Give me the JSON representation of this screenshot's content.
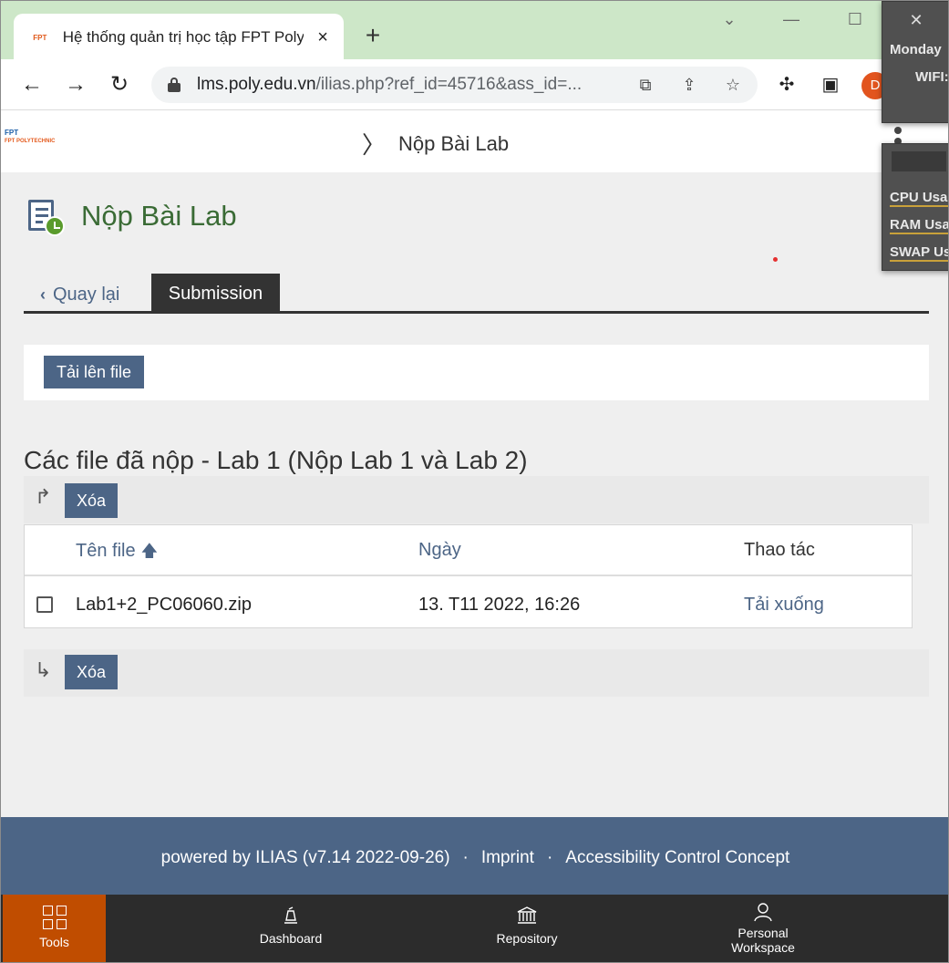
{
  "browser": {
    "tab_title": "Hệ thống quản trị học tập FPT Polytechnic",
    "tab_close": "×",
    "new_tab": "+",
    "url_host": "lms.poly.edu.vn",
    "url_rest": "/ilias.php?ref_id=45716&ass_id=...",
    "profile_initial": "D"
  },
  "overlay": {
    "day": "Monday",
    "wifi": "WIFI:",
    "cpu": "CPU Usag",
    "ram": "RAM Usag",
    "swap": "SWAP Us"
  },
  "header": {
    "logo_top": "FPT",
    "logo_bottom": "FPT POLYTECHNIC",
    "breadcrumb": "Nộp Bài Lab"
  },
  "page": {
    "title": "Nộp Bài Lab",
    "tabs": {
      "back": "Quay lại",
      "active": "Submission"
    },
    "upload_button": "Tải lên file",
    "section_title": "Các file đã nộp - Lab 1 (Nộp Lab 1 và Lab 2)",
    "delete_button": "Xóa",
    "table": {
      "columns": [
        "Tên file",
        "Ngày",
        "Thao tác"
      ],
      "rows": [
        {
          "file": "Lab1+2_PC06060.zip",
          "date": "13. T11 2022, 16:26",
          "action": "Tải xuống"
        }
      ]
    }
  },
  "footer": {
    "powered": "powered by ILIAS (v7.14 2022-09-26)",
    "imprint": "Imprint",
    "accessibility": "Accessibility Control Concept",
    "separator": "·"
  },
  "bottom_nav": {
    "tools": "Tools",
    "dashboard": "Dashboard",
    "repository": "Repository",
    "personal_line1": "Personal",
    "personal_line2": "Workspace"
  },
  "colors": {
    "accent": "#4c6586",
    "title_green": "#3a6b35",
    "active_nav": "#c04d00",
    "tabstrip": "#cde7c8"
  }
}
